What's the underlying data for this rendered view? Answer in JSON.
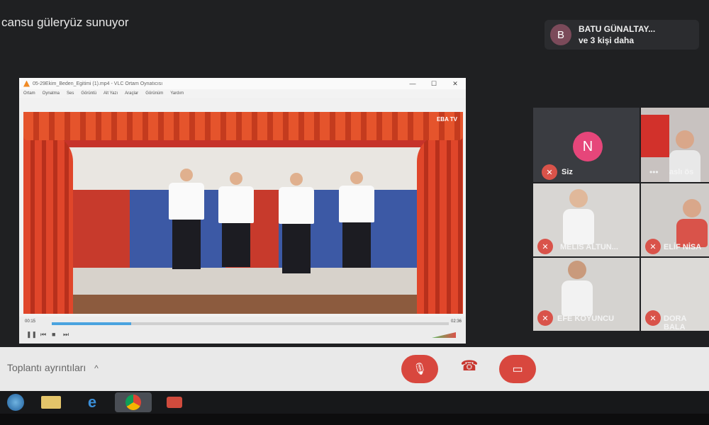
{
  "meet": {
    "presenter_text": "cansu güleryüz sunuyor",
    "participants": {
      "avatar_letter": "B",
      "name": "BATU GÜNALTAY...",
      "others": "ve 3 kişi daha"
    },
    "tiles": [
      {
        "name": "Siz",
        "avatar_letter": "N"
      },
      {
        "name": "aslı ös"
      },
      {
        "name": "MELİS ALTUN..."
      },
      {
        "name": "ELİF NİSA"
      },
      {
        "name": "EFE KOYUNCU"
      },
      {
        "name": "DORA BALA"
      }
    ],
    "bottom": {
      "meeting_details": "Toplantı ayrıntıları",
      "chevron": "^"
    }
  },
  "vlc": {
    "title": "05-29Ekim_Beden_Egitimi (1).mp4 - VLC Ortam Oynatıcısı",
    "menu": [
      "Ortam",
      "Oynatma",
      "Ses",
      "Görüntü",
      "Alt Yazı",
      "Araçlar",
      "Görünüm",
      "Yardım"
    ],
    "window_buttons": [
      "—",
      "☐",
      "✕"
    ],
    "time_elapsed": "00:15",
    "time_total": "02:36",
    "overlay_logo": "EBA TV",
    "progress": 0.2
  },
  "colors": {
    "mute_red": "#d9534a",
    "avatar_pink": "#e6467a"
  }
}
